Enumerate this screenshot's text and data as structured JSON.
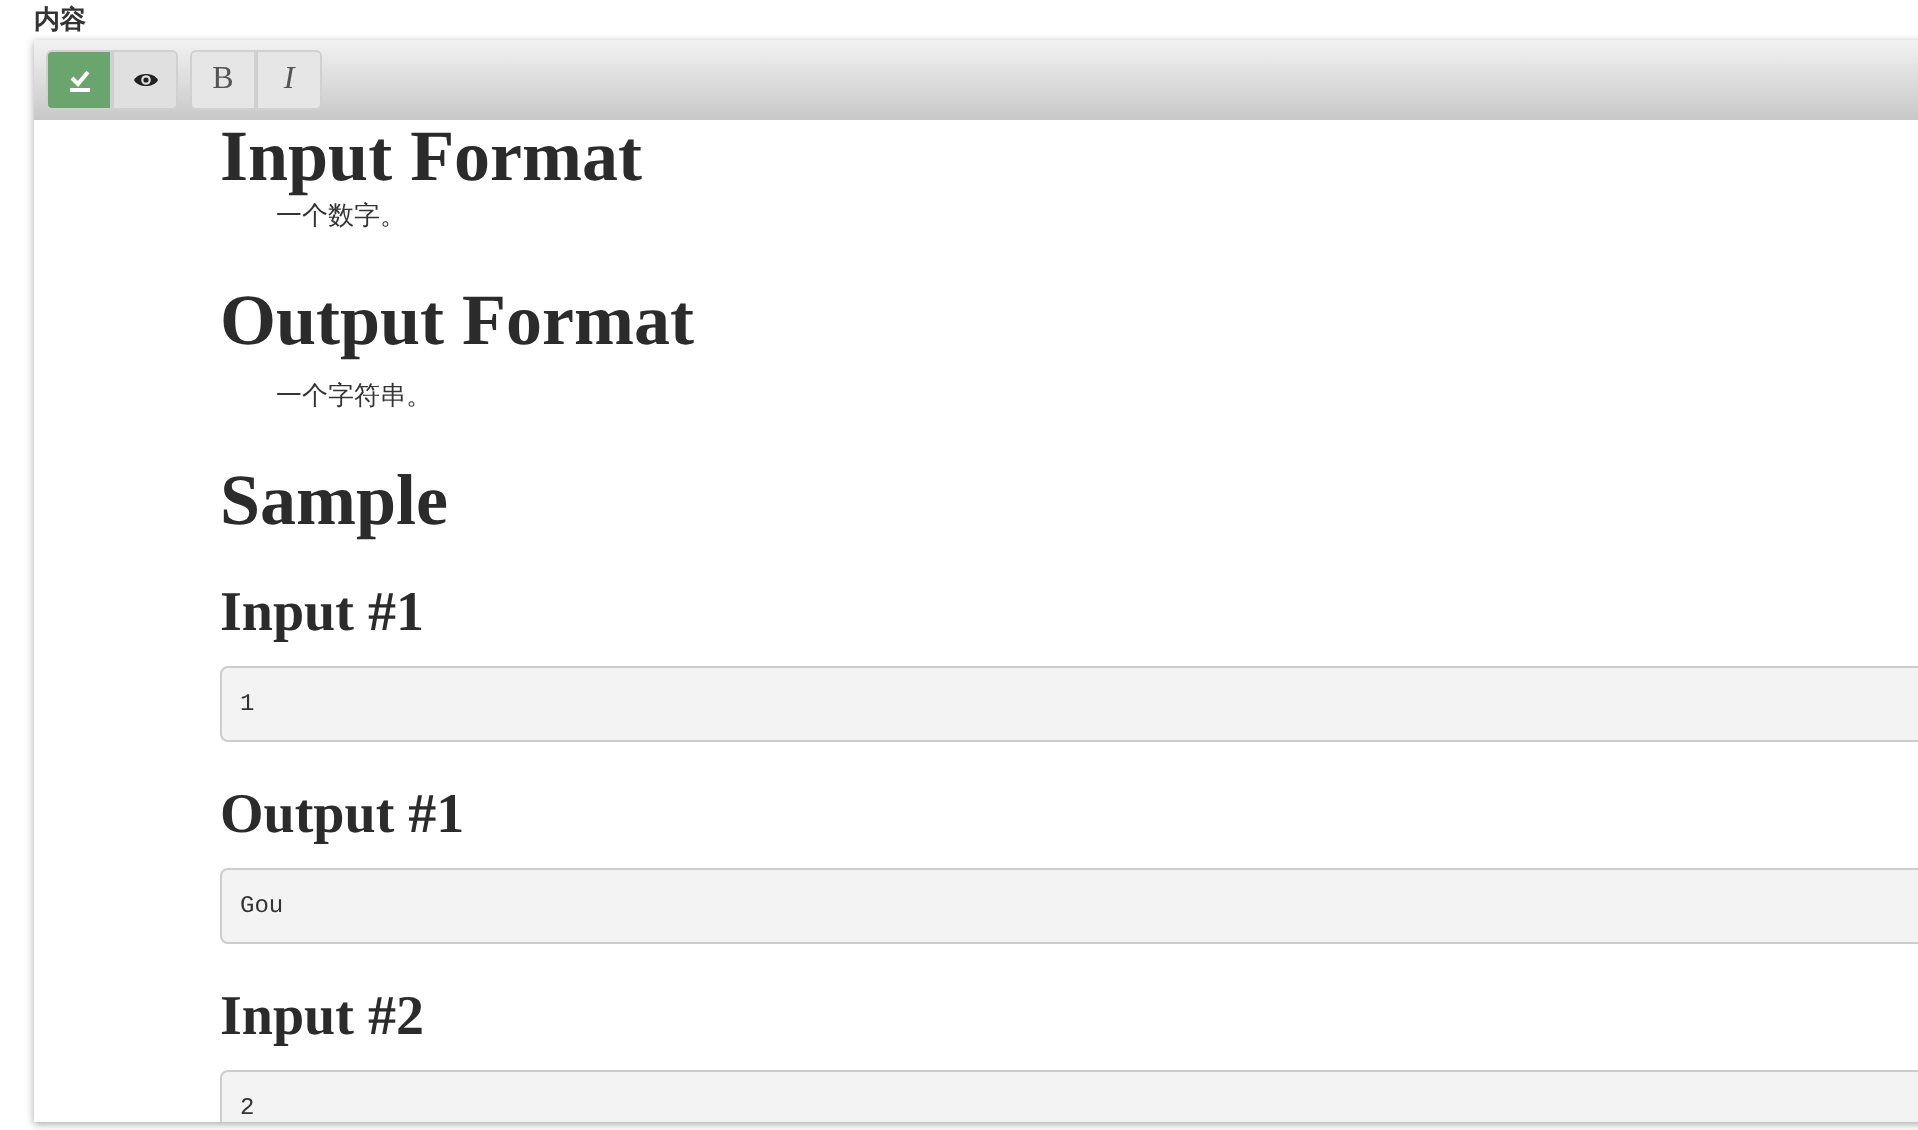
{
  "label": "内容",
  "toolbar": [
    {
      "kind": "edit",
      "selected": true
    },
    {
      "kind": "preview",
      "selected": false
    },
    {
      "kind": "bold",
      "text": "B"
    },
    {
      "kind": "italic",
      "text": "I"
    }
  ],
  "content": [
    {
      "kind": "heading1",
      "text": "Input Format"
    },
    {
      "kind": "paragraph",
      "text": "一个数字。"
    },
    {
      "kind": "heading1",
      "text": "Output Format"
    },
    {
      "kind": "paragraph",
      "text": "一个字符串。"
    },
    {
      "kind": "heading1",
      "text": "Sample"
    },
    {
      "kind": "heading2",
      "text": "Input #1"
    },
    {
      "kind": "code",
      "text": "1"
    },
    {
      "kind": "heading2",
      "text": "Output #1"
    },
    {
      "kind": "code",
      "text": "Gou"
    },
    {
      "kind": "heading2",
      "text": "Input #2"
    },
    {
      "kind": "code",
      "text": "2"
    }
  ]
}
